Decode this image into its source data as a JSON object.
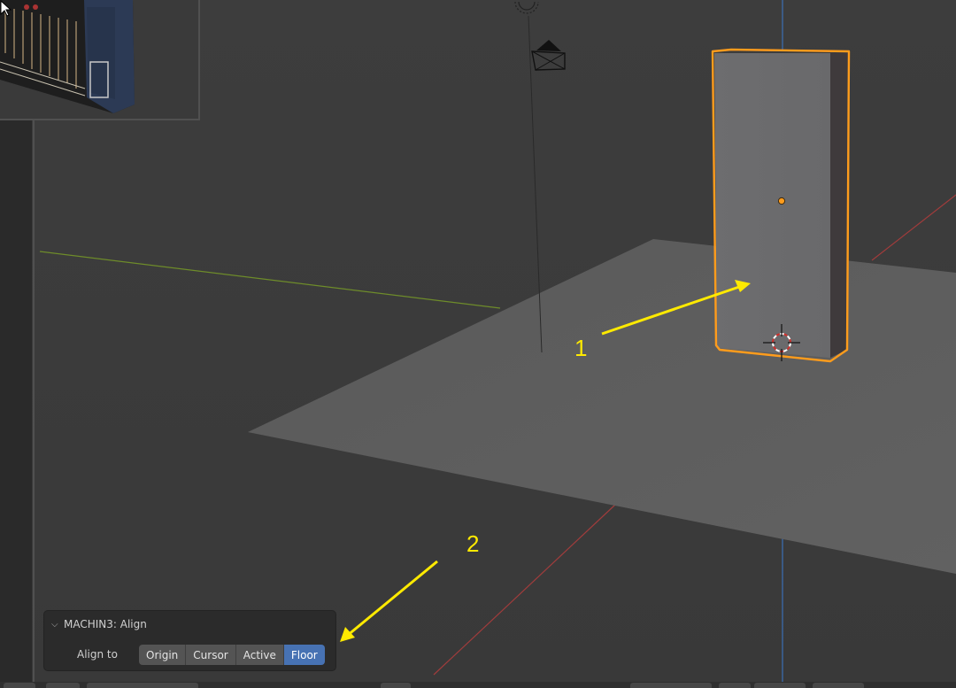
{
  "annotations": {
    "label_1": "1",
    "label_2": "2",
    "color": "#ffea00"
  },
  "redo_panel": {
    "title": "MACHIN3: Align",
    "align_label": "Align to",
    "options": [
      "Origin",
      "Cursor",
      "Active",
      "Floor"
    ],
    "selected": "Floor"
  },
  "colors": {
    "viewport_bg": "#3c3c3c",
    "selection_outline": "#ff9c1c",
    "active_button": "#4772b3",
    "x_axis": "#a03c3c",
    "y_axis": "#6e8c2a",
    "z_axis": "#3b6fb5"
  },
  "icons": [
    "camera-icon",
    "light-icon",
    "3d-cursor-icon",
    "object-origin-icon",
    "mouse-pointer-icon",
    "chevron-down-icon"
  ]
}
